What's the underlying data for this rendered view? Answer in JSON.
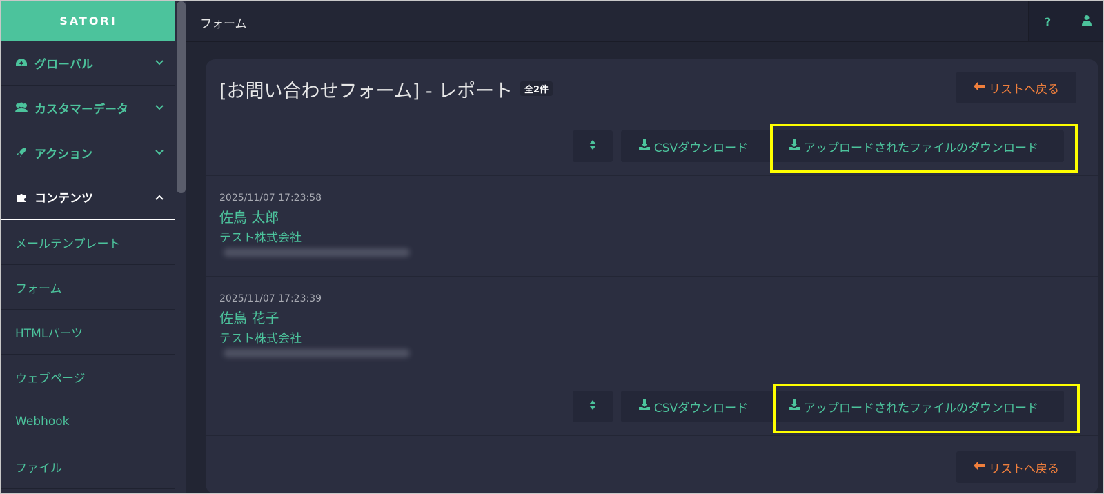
{
  "app": {
    "logo": "SATORI"
  },
  "sidebar": {
    "groups": [
      {
        "label": "グローバル",
        "icon": "dashboard-icon"
      },
      {
        "label": "カスタマーデータ",
        "icon": "users-icon"
      },
      {
        "label": "アクション",
        "icon": "rocket-icon"
      },
      {
        "label": "コンテンツ",
        "icon": "puzzle-icon"
      }
    ],
    "items": [
      {
        "label": "メールテンプレート"
      },
      {
        "label": "フォーム"
      },
      {
        "label": "HTMLパーツ"
      },
      {
        "label": "ウェブページ"
      },
      {
        "label": "Webhook"
      },
      {
        "label": "ファイル"
      }
    ]
  },
  "header": {
    "title": "フォーム",
    "help_label": "?",
    "user_icon": "user-icon"
  },
  "main": {
    "title": "[お問い合わせフォーム] - レポート",
    "count_badge": "全2件",
    "back_label": "リストへ戻る",
    "toolbar": {
      "csv_label": "CSVダウンロード",
      "upload_dl_label": "アップロードされたファイルのダウンロード"
    },
    "entries": [
      {
        "timestamp": "2025/11/07 17:23:58",
        "name": "佐鳥 太郎",
        "company": "テスト株式会社"
      },
      {
        "timestamp": "2025/11/07 17:23:39",
        "name": "佐鳥 花子",
        "company": "テスト株式会社"
      }
    ]
  },
  "colors": {
    "accent": "#4cc39c",
    "back": "#f07f3c",
    "highlight": "#ffff00",
    "bg": "#222533"
  }
}
